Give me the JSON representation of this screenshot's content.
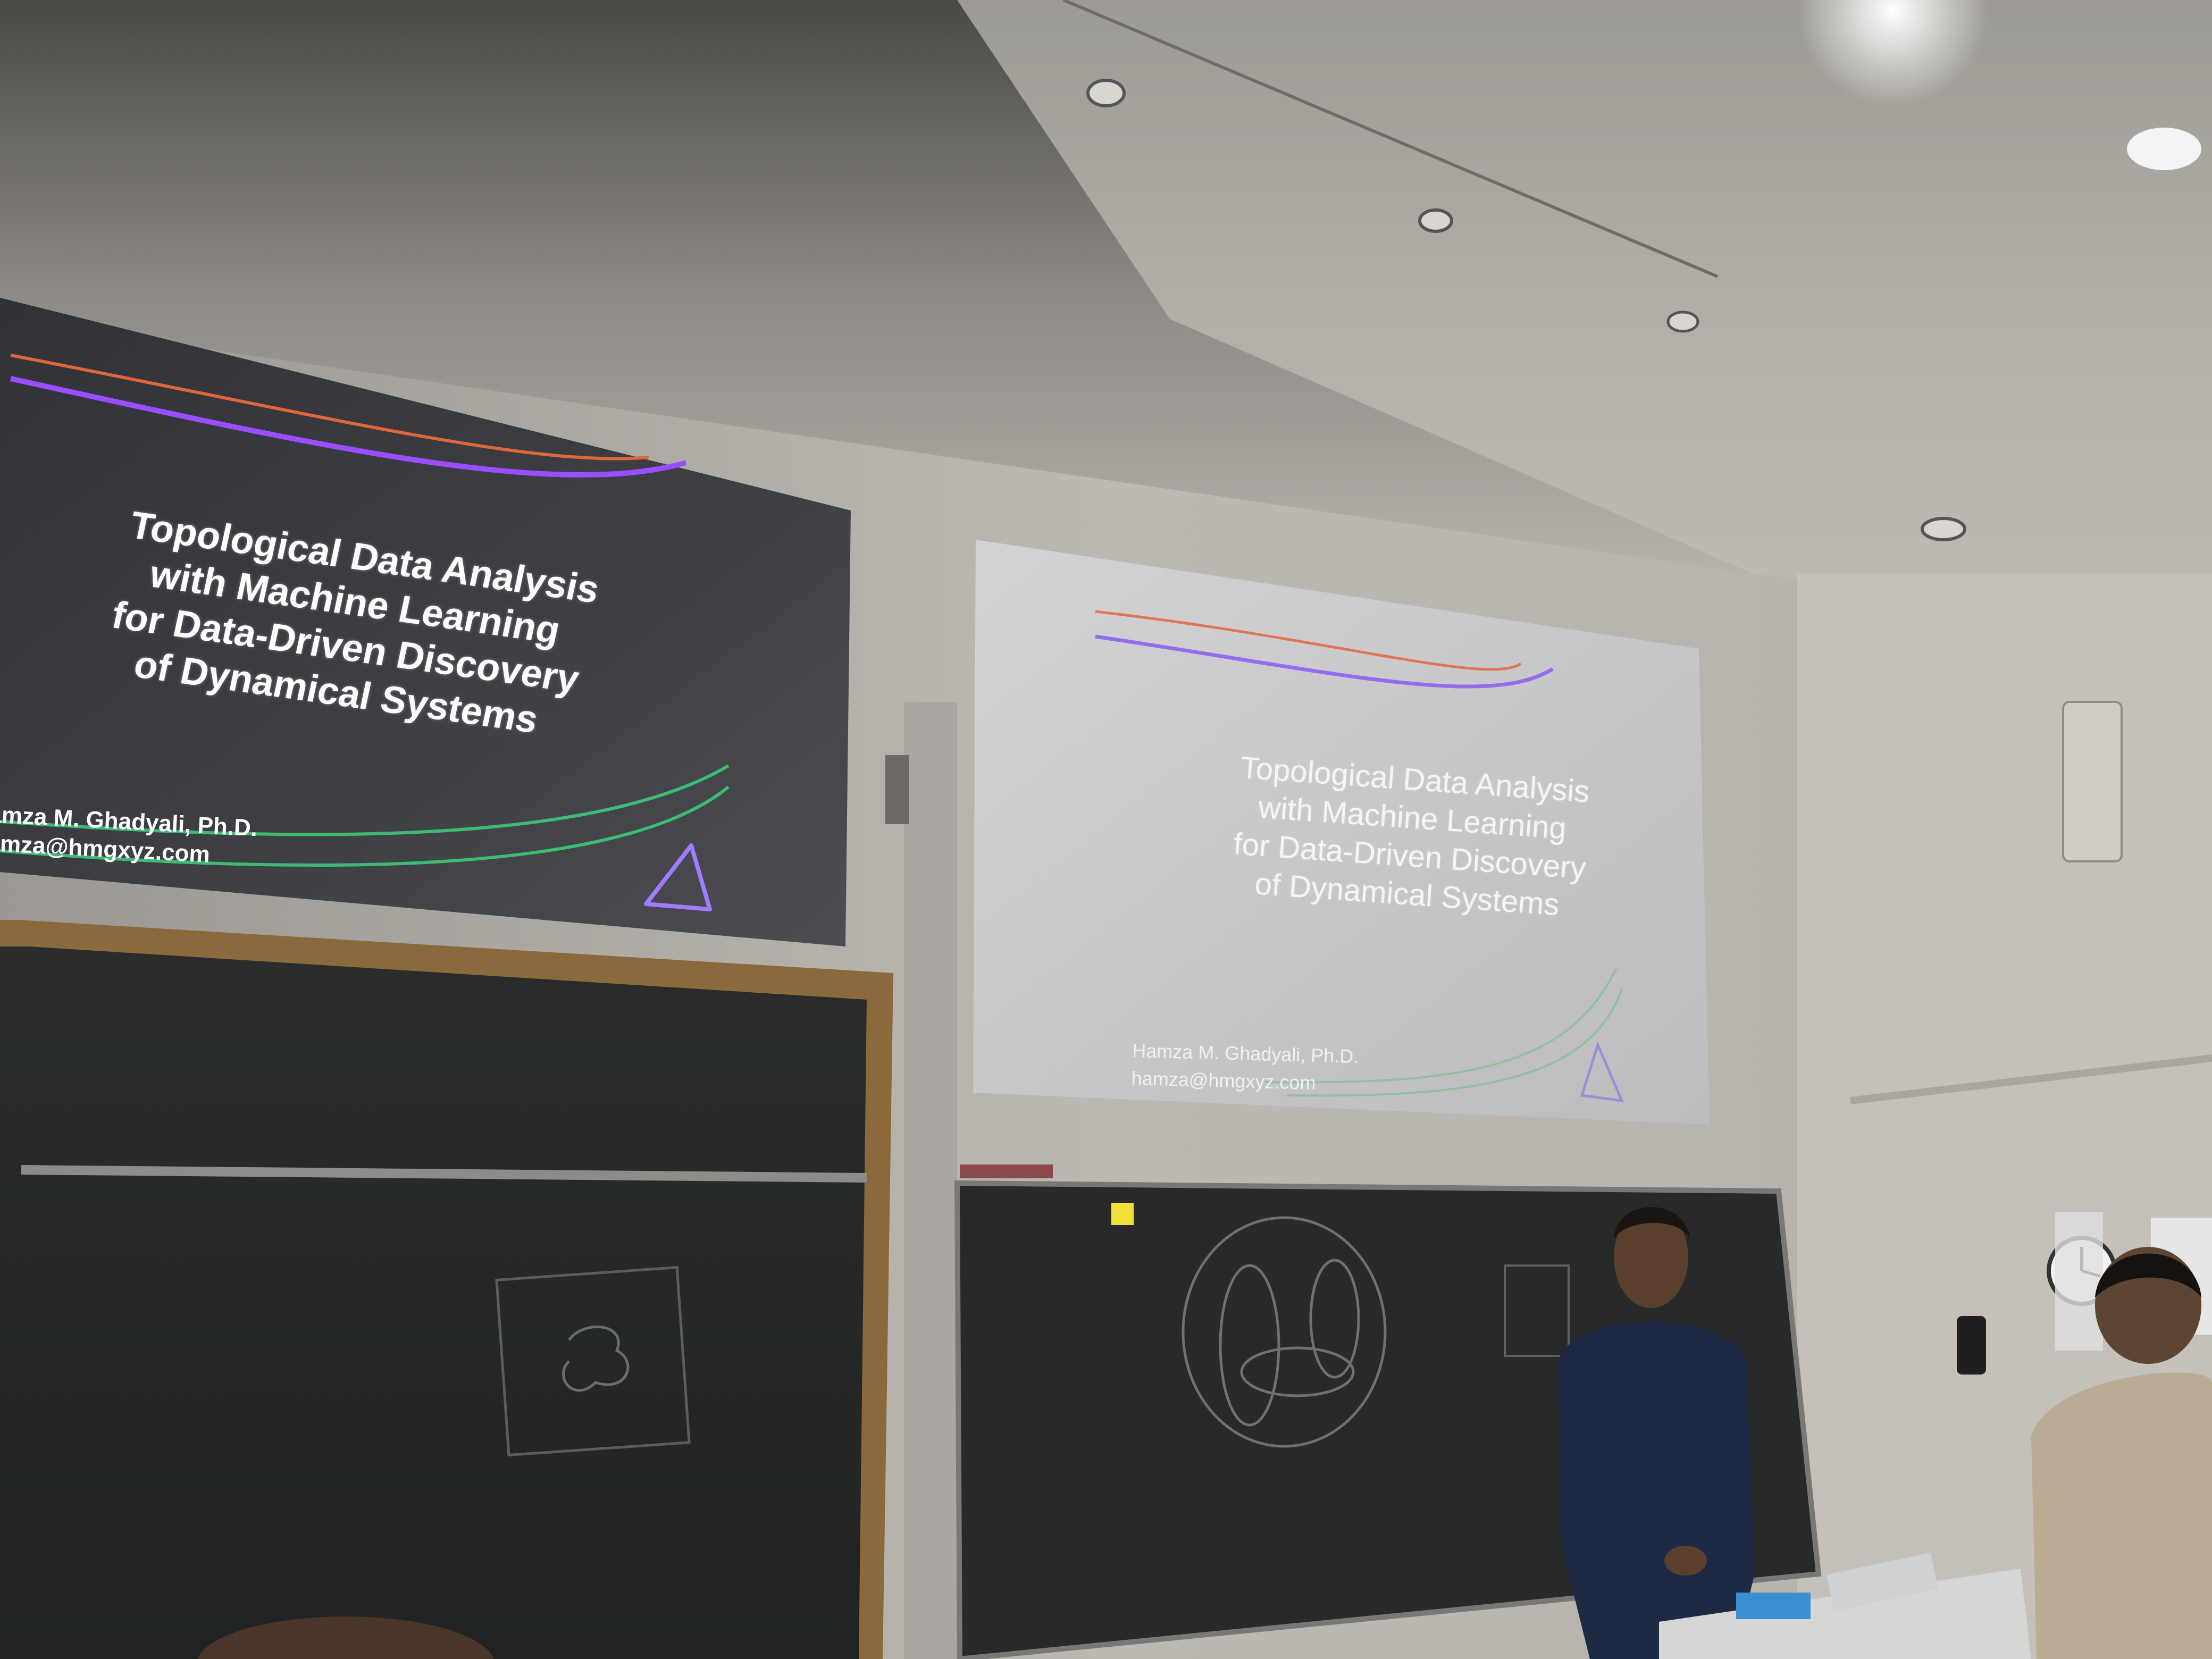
{
  "colors": {
    "left_slide_bg": "#3a3c42",
    "right_slide_bg": "#c9c9cb",
    "wall": "#bdb9b3",
    "ceiling": "#a8a5a0",
    "chalkboard": "#1c1f1e",
    "accent_orange": "#e3663b",
    "accent_purple": "#9b4dff",
    "accent_green": "#3dbb74"
  },
  "left_slide": {
    "title_lines": [
      "Topological Data Analysis",
      "with Machine Learning",
      "for Data-Driven Discovery",
      "of Dynamical Systems"
    ],
    "author": "amza M. Ghadyali, Ph.D.",
    "email": "amza@hmgxyz.com"
  },
  "right_slide": {
    "title_lines": [
      "Topological Data Analysis",
      "with Machine Learning",
      "for Data-Driven Discovery",
      "of Dynamical Systems"
    ],
    "author": "Hamza M. Ghadyali, Ph.D.",
    "email": "hamza@hmgxyz.com"
  }
}
